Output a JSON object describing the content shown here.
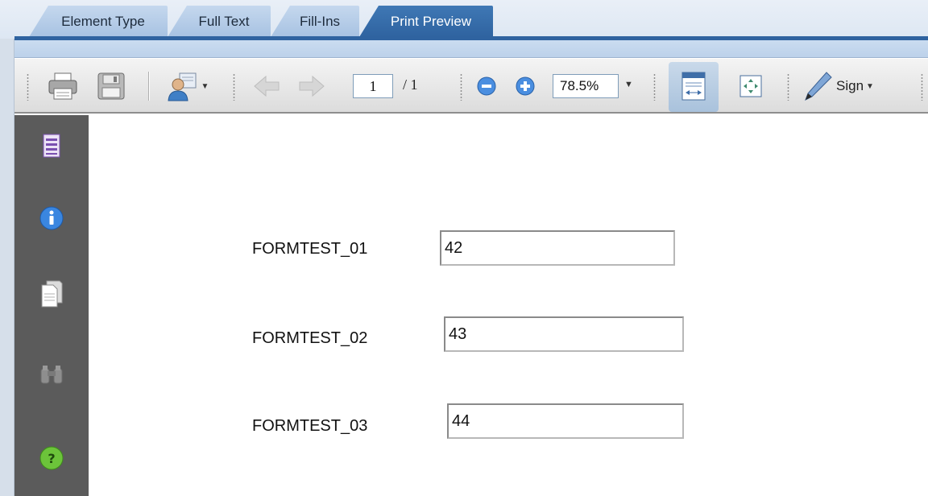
{
  "tabs": [
    {
      "label": "Element Type",
      "active": false
    },
    {
      "label": "Full Text",
      "active": false
    },
    {
      "label": "Fill-Ins",
      "active": false
    },
    {
      "label": "Print Preview",
      "active": true
    }
  ],
  "toolbar": {
    "page_current": "1",
    "page_total": "/ 1",
    "zoom_value": "78.5%",
    "sign_label": "Sign",
    "icons": [
      "print-icon",
      "save-icon",
      "account-icon",
      "previous-page-icon",
      "next-page-icon",
      "zoom-out-icon",
      "zoom-in-icon",
      "fit-width-icon",
      "fit-page-icon",
      "pen-icon"
    ]
  },
  "navpanel": {
    "icons": [
      "pages-icon",
      "info-icon",
      "attachments-icon",
      "search-icon",
      "help-icon"
    ]
  },
  "document": {
    "fields": [
      {
        "label": "FORMTEST_01",
        "value": "42"
      },
      {
        "label": "FORMTEST_02",
        "value": "43"
      },
      {
        "label": "FORMTEST_03",
        "value": "44"
      }
    ]
  },
  "colors": {
    "active_tab": "#2f63a0",
    "inactive_tab": "#b8cfe9",
    "nav_panel": "#5b5b5b",
    "toolbar": "#e8e8e8"
  }
}
